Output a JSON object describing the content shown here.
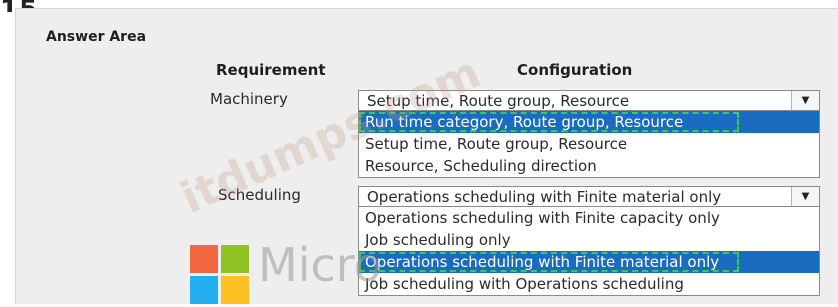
{
  "partial_top_text": "15.",
  "panel": {
    "title": "Answer Area",
    "headers": {
      "requirement": "Requirement",
      "configuration": "Configuration"
    }
  },
  "rows": [
    {
      "label": "Machinery",
      "selected": "Setup time, Route group, Resource",
      "options": [
        "Run time category, Route group, Resource",
        "Setup time, Route group, Resource",
        "Resource, Scheduling direction"
      ]
    },
    {
      "label": "Scheduling",
      "selected": "Operations scheduling with Finite material only",
      "options": [
        "Operations scheduling with Finite capacity only",
        "Job scheduling only",
        "Operations scheduling with Finite material only",
        "Job scheduling with Operations scheduling"
      ]
    }
  ],
  "watermark": {
    "diagonal": "itdumps.com",
    "brand": "Micro"
  },
  "colors": {
    "highlight": "#1a6cc0",
    "dashed_marker": "#3ec85a",
    "panel_bg": "#eeeeee"
  }
}
